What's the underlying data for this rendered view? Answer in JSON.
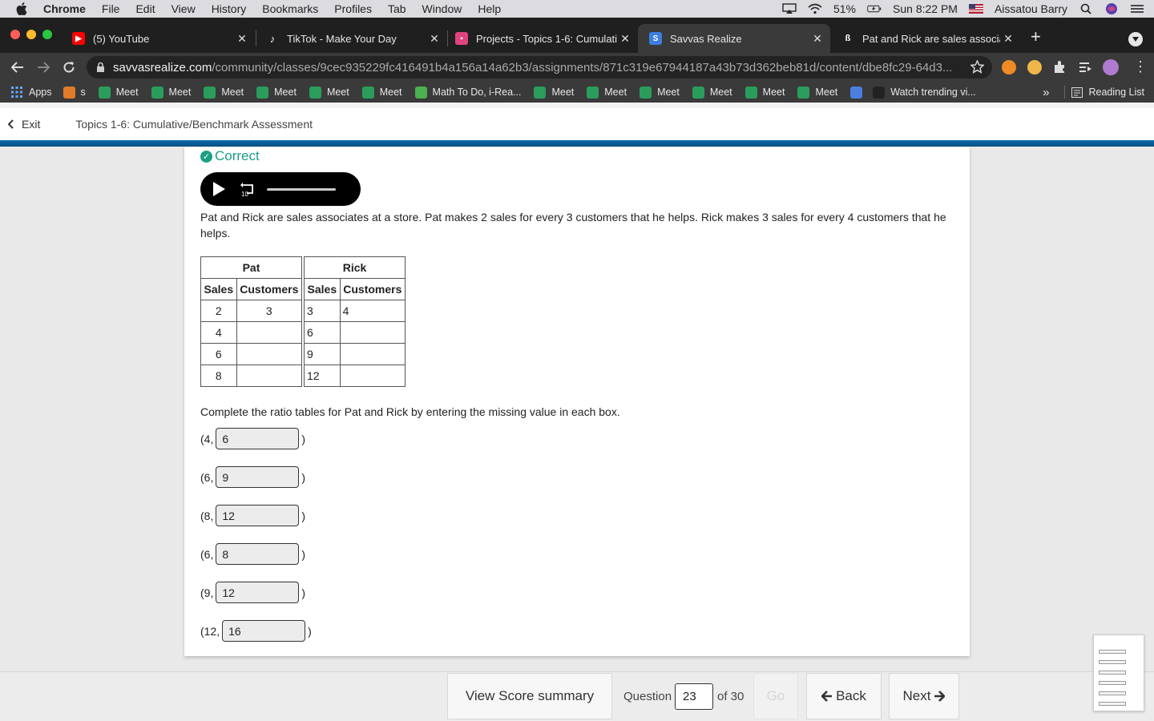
{
  "menubar": {
    "app_name": "Chrome",
    "items": [
      "File",
      "Edit",
      "View",
      "History",
      "Bookmarks",
      "Profiles",
      "Tab",
      "Window",
      "Help"
    ],
    "battery": "51%",
    "datetime": "Sun 8:22 PM",
    "user": "Aissatou Barry"
  },
  "tabs": [
    {
      "title": "(5) YouTube"
    },
    {
      "title": "TikTok - Make Your Day"
    },
    {
      "title": "Projects - Topics 1-6: Cumulati"
    },
    {
      "title": "Savvas Realize"
    },
    {
      "title": "Pat and Rick are sales associat"
    }
  ],
  "address": {
    "host": "savvasrealize.com",
    "path": "/community/classes/9cec935229fc416491b4a156a14a62b3/assignments/871c319e67944187a43b73d362beb81d/content/dbe8fc29-64d3..."
  },
  "bookmarks": {
    "items": [
      "Apps",
      "s",
      "Meet",
      "Meet",
      "Meet",
      "Meet",
      "Meet",
      "Meet",
      "Math To Do, i-Rea...",
      "Meet",
      "Meet",
      "Meet",
      "Meet",
      "Meet",
      "Meet",
      "Watch trending vi..."
    ],
    "overflow": "»",
    "reading_list": "Reading List"
  },
  "header": {
    "exit_label": "Exit",
    "breadcrumb": "Topics 1-6: Cumulative/Benchmark Assessment"
  },
  "question": {
    "status": "Correct",
    "prompt": "Pat and Rick are sales associates at a store. Pat makes 2 sales for every 3 customers that he helps. Rick makes 3 sales for every 4 customers that he helps.",
    "pat_title": "Pat",
    "rick_title": "Rick",
    "col_sales": "Sales",
    "col_customers": "Customers",
    "pat_rows": [
      [
        "2",
        "3"
      ],
      [
        "4",
        ""
      ],
      [
        "6",
        ""
      ],
      [
        "8",
        ""
      ]
    ],
    "rick_rows": [
      [
        "3",
        "4"
      ],
      [
        "6",
        ""
      ],
      [
        "9",
        ""
      ],
      [
        "12",
        ""
      ]
    ],
    "instruction": "Complete the ratio tables for Pat and Rick by entering the missing value in each box.",
    "answers": [
      {
        "prefix": "(4,",
        "value": "6",
        "suffix": ")"
      },
      {
        "prefix": "(6,",
        "value": "9",
        "suffix": ")"
      },
      {
        "prefix": "(8,",
        "value": "12",
        "suffix": ")"
      },
      {
        "prefix": "(6,",
        "value": "8",
        "suffix": ")"
      },
      {
        "prefix": "(9,",
        "value": "12",
        "suffix": ")"
      },
      {
        "prefix": "(12,",
        "value": "16",
        "suffix": ")"
      }
    ]
  },
  "footer": {
    "score_summary": "View Score summary",
    "question_label": "Question",
    "question_number": "23",
    "of_total": "of 30",
    "go_label": "Go",
    "back_label": "Back",
    "next_label": "Next"
  },
  "colors": {
    "correct_green": "#1a9f82",
    "brand_blue": "#0a6ab0"
  }
}
